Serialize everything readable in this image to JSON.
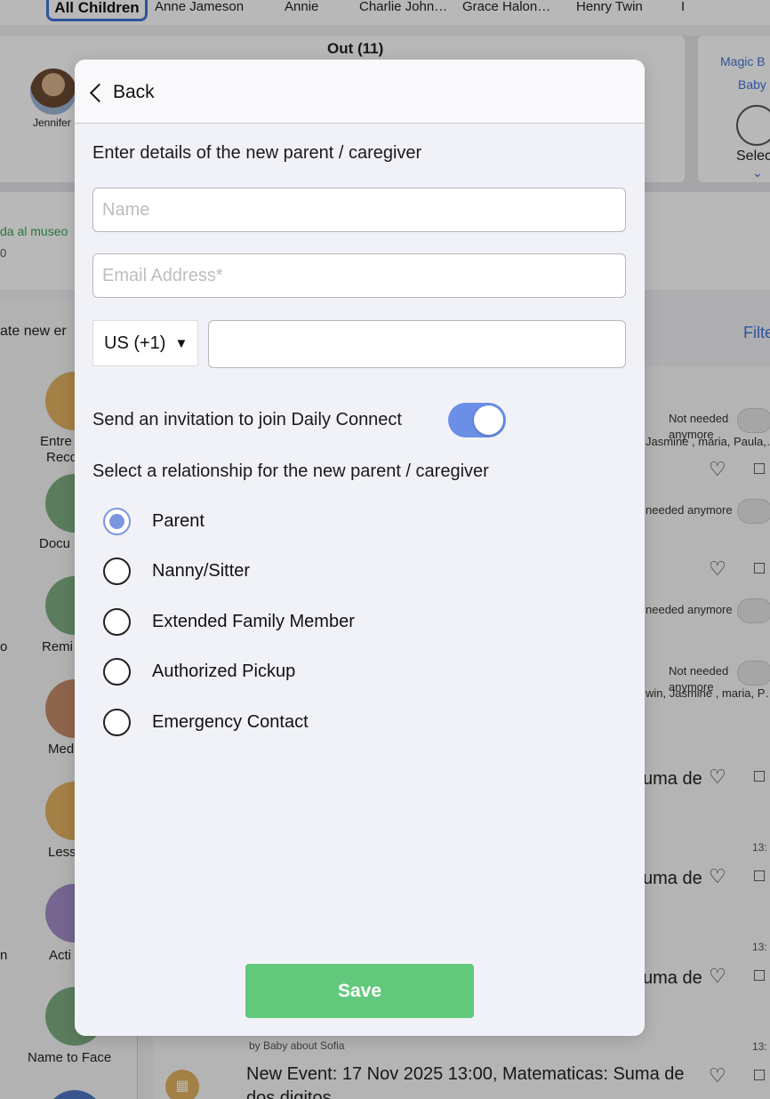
{
  "background": {
    "child_tabs": [
      "All Children",
      "Anne Jameson",
      "Annie",
      "Charlie John…",
      "Grace Halon…",
      "Henry Twin",
      "I"
    ],
    "out_label": "Out (11)",
    "avatar_name": "Jennifer",
    "magic_line1": "Magic B",
    "magic_line2": "Baby",
    "select_label": "Selec",
    "museo_title": "da al museo",
    "museo_sub": "0",
    "create_new_label": "ate new er",
    "filter_label": "Filte",
    "side_items": [
      "Entre",
      "Reco",
      "Docu",
      "Remi",
      "Med",
      "Less",
      "Acti",
      "Name to Face"
    ],
    "left_fragments": [
      "o",
      "n"
    ],
    "not_needed": "Not needed anymore",
    "needed_anymore": "needed anymore",
    "feed_names_1": "Jasmine , maria, Paula,…",
    "feed_names_2": "win, Jasmine , maria, P…",
    "feed_title_fragment": "uma de",
    "time_fragment": "13:",
    "byline": "by Baby about Sofia",
    "event_line1": "New Event: 17 Nov 2025 13:00, Matematicas: Suma de",
    "event_line2": "dos digitos"
  },
  "modal": {
    "back_label": "Back",
    "section_title": "Enter details of the new parent / caregiver",
    "name_placeholder": "Name",
    "email_placeholder": "Email Address*",
    "country_code": "US (+1)",
    "phone_value": "",
    "invite_label": "Send an invitation to join Daily Connect",
    "invite_enabled": true,
    "relationship_title": "Select a relationship for the new parent / caregiver",
    "relationships": [
      {
        "label": "Parent",
        "selected": true
      },
      {
        "label": "Nanny/Sitter",
        "selected": false
      },
      {
        "label": "Extended Family Member",
        "selected": false
      },
      {
        "label": "Authorized Pickup",
        "selected": false
      },
      {
        "label": "Emergency Contact",
        "selected": false
      }
    ],
    "save_label": "Save"
  },
  "colors": {
    "accent_blue": "#6b8fe6",
    "radio_selected": "#7b96e0",
    "save_green": "#62c97c",
    "link_blue": "#3f73d9"
  }
}
